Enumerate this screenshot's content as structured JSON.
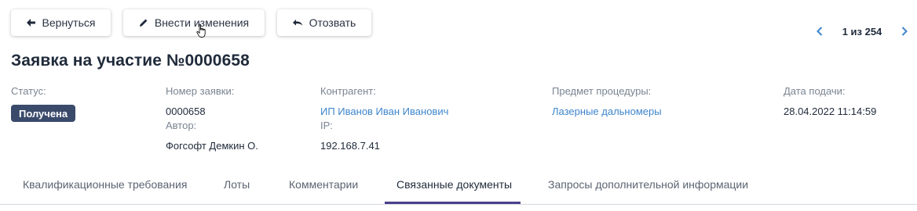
{
  "toolbar": {
    "back_label": "Вернуться",
    "edit_label": "Внести изменения",
    "revoke_label": "Отозвать"
  },
  "pager": {
    "text": "1 из 254"
  },
  "page_title": "Заявка на участие №0000658",
  "details": {
    "status_label": "Статус:",
    "status_value": "Получена",
    "number_label": "Номер заявки:",
    "number_value": "0000658",
    "author_label": "Автор:",
    "author_value": "Фогсофт Демкин О.",
    "counterparty_label": "Контрагент:",
    "counterparty_value": "ИП Иванов Иван Иванович",
    "ip_label": "IP:",
    "ip_value": "192.168.7.41",
    "subject_label": "Предмет процедуры:",
    "subject_value": "Лазерные дальномеры",
    "date_label": "Дата подачи:",
    "date_value": "28.04.2022 11:14:59"
  },
  "tabs": [
    {
      "label": "Квалификационные требования",
      "active": false
    },
    {
      "label": "Лоты",
      "active": false
    },
    {
      "label": "Комментарии",
      "active": false
    },
    {
      "label": "Связанные документы",
      "active": true
    },
    {
      "label": "Запросы дополнительной информации",
      "active": false
    }
  ],
  "colors": {
    "accent_link": "#3f86cc",
    "badge_bg": "#3a4a6b",
    "active_tab_underline": "#4a3f8c",
    "text_dark": "#1f2a3a",
    "label_gray": "#7a8491"
  },
  "icons": {
    "back": "arrow-left-icon",
    "edit": "pencil-icon",
    "revoke": "undo-icon",
    "prev": "chevron-left-icon",
    "next": "chevron-right-icon",
    "cursor": "hand-pointer-cursor"
  }
}
